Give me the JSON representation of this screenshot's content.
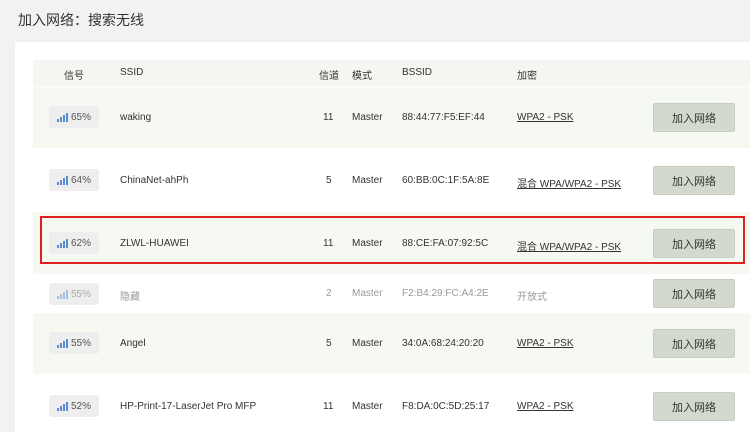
{
  "page": {
    "title": "加入网络：搜索无线"
  },
  "table": {
    "headers": {
      "signal": "信号",
      "ssid": "SSID",
      "channel": "信道",
      "mode": "模式",
      "bssid": "BSSID",
      "encryption": "加密"
    },
    "rows": [
      {
        "signal": "65%",
        "ssid": "waking",
        "channel": "11",
        "mode": "Master",
        "bssid": "88:44:77:F5:EF:44",
        "encryption": "WPA2 - PSK",
        "button": "加入网络"
      },
      {
        "signal": "64%",
        "ssid": "ChinaNet-ahPh",
        "channel": "5",
        "mode": "Master",
        "bssid": "60:BB:0C:1F:5A:8E",
        "encryption": "混合 WPA/WPA2 - PSK",
        "button": "加入网络"
      },
      {
        "signal": "62%",
        "ssid": "ZLWL-HUAWEI",
        "channel": "11",
        "mode": "Master",
        "bssid": "88:CE:FA:07:92:5C",
        "encryption": "混合 WPA/WPA2 - PSK",
        "button": "加入网络"
      },
      {
        "signal": "55%",
        "ssid": "隐藏",
        "channel": "2",
        "mode": "Master",
        "bssid": "F2:B4:29:FC:A4:2E",
        "encryption": "开放式",
        "button": "加入网络"
      },
      {
        "signal": "55%",
        "ssid": "Angel",
        "channel": "5",
        "mode": "Master",
        "bssid": "34:0A:68:24:20:20",
        "encryption": "WPA2 - PSK",
        "button": "加入网络"
      },
      {
        "signal": "52%",
        "ssid": "HP-Print-17-LaserJet Pro MFP",
        "channel": "11",
        "mode": "Master",
        "bssid": "F8:DA:0C:5D:25:17",
        "encryption": "WPA2 - PSK",
        "button": "加入网络"
      }
    ]
  },
  "colors": {
    "highlight_border": "#e02020",
    "signal_bars": "#5b8bd0",
    "button_bg": "#d3d9cd"
  }
}
